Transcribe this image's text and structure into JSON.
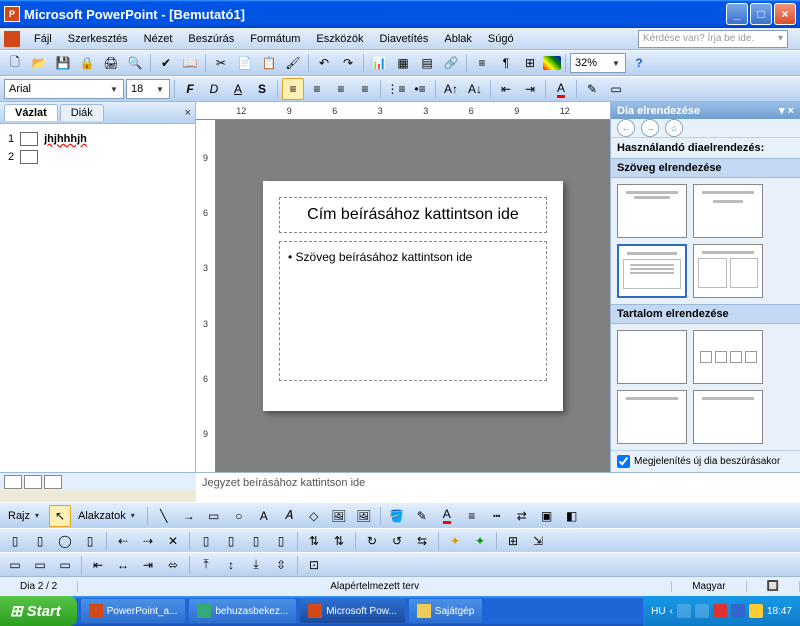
{
  "app": {
    "title": "Microsoft PowerPoint - [Bemutató1]"
  },
  "menu": {
    "file": "Fájl",
    "edit": "Szerkesztés",
    "view": "Nézet",
    "insert": "Beszúrás",
    "format": "Formátum",
    "tools": "Eszközök",
    "slideshow": "Diavetítés",
    "window": "Ablak",
    "help": "Súgó"
  },
  "questionBox": {
    "placeholder": "Kérdése van? Írja be ide."
  },
  "zoom": {
    "value": "32%"
  },
  "font": {
    "name": "Arial",
    "size": "18"
  },
  "outline": {
    "tab1": "Vázlat",
    "tab2": "Diák",
    "item1_num": "1",
    "item1_text": "jhjhhhjh",
    "item2_num": "2"
  },
  "ruler": {
    "h": [
      "12",
      "9",
      "6",
      "3",
      "3",
      "6",
      "9",
      "12"
    ],
    "v": [
      "9",
      "6",
      "3",
      "3",
      "6",
      "9"
    ]
  },
  "slide": {
    "titlePlaceholder": "Cím beírásához kattintson ide",
    "bodyPlaceholder": "Szöveg beírásához kattintson ide"
  },
  "notes": {
    "placeholder": "Jegyzet beírásához kattintson ide"
  },
  "taskpane": {
    "title": "Dia elrendezése",
    "heading": "Használandó diaelrendezés:",
    "section1": "Szöveg elrendezése",
    "section2": "Tartalom elrendezése",
    "checkbox": "Megjelenítés új dia beszúrásakor"
  },
  "drawToolbar": {
    "rajz": "Rajz",
    "alakzatok": "Alakzatok"
  },
  "status": {
    "slideCount": "Dia 2 / 2",
    "design": "Alapértelmezett terv",
    "lang": "Magyar"
  },
  "taskbar": {
    "start": "Start",
    "items": [
      "PowerPoint_a...",
      "behuzasbekez...",
      "Microsoft Pow...",
      "Sajátgép"
    ],
    "langInd": "HU",
    "clock": "18:47"
  }
}
